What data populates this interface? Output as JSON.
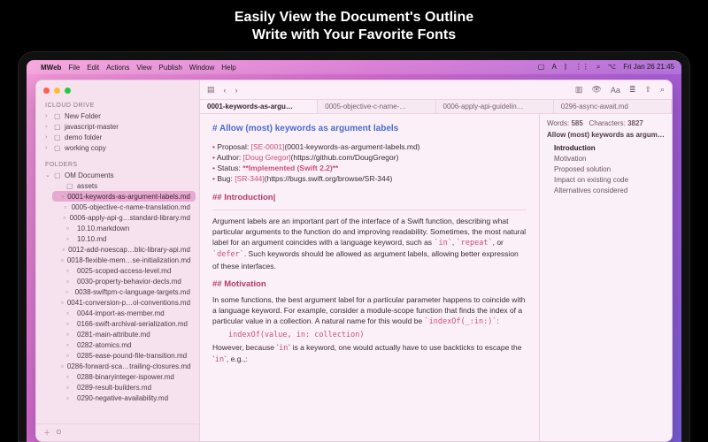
{
  "promo": {
    "headline1": "Easily View the Document's Outline",
    "headline2": "Write with Your Favorite Fonts"
  },
  "menubar": {
    "app": "MWeb",
    "items": [
      "File",
      "Edit",
      "Actions",
      "View",
      "Publish",
      "Window",
      "Help"
    ],
    "clock": "Fri Jan 26  21:45"
  },
  "sidebar": {
    "section_cloud": "ICLOUD DRIVE",
    "cloud_items": [
      {
        "label": "New Folder",
        "kind": "folder",
        "expandable": true
      },
      {
        "label": "javascript-master",
        "kind": "folder",
        "expandable": true
      },
      {
        "label": "demo folder",
        "kind": "folder",
        "expandable": true
      },
      {
        "label": "working copy",
        "kind": "folder",
        "expandable": true
      }
    ],
    "section_folders": "FOLDERS",
    "root": {
      "label": "OM Documents",
      "open": true
    },
    "assets": {
      "label": "assets"
    },
    "files": [
      "0001-keywords-as-argument-labels.md",
      "0005-objective-c-name-translation.md",
      "0006-apply-api-g…standard-library.md",
      "10.10.markdown",
      "10.10.md",
      "0012-add-noescap…blic-library-api.md",
      "0018-flexible-mem…se-initialization.md",
      "0025-scoped-access-level.md",
      "0030-property-behavior-decls.md",
      "0038-swiftpm-c-language-targets.md",
      "0041-conversion-p…ol-conventions.md",
      "0044-import-as-member.md",
      "0166-swift-archival-serialization.md",
      "0281-main-attribute.md",
      "0282-atomics.md",
      "0285-ease-pound-file-transition.md",
      "0286-forward-sca…trailing-closures.md",
      "0288-binaryinteger-ispower.md",
      "0289-result-builders.md",
      "0290-negative-availability.md"
    ],
    "selected_index": 0
  },
  "toolbar": {
    "icons": [
      "sidebar",
      "back",
      "forward"
    ],
    "right_icons": [
      "preview",
      "eye",
      "font",
      "outline",
      "share",
      "search"
    ],
    "font_label": "Aa"
  },
  "tabs": {
    "items": [
      "0001-keywords-as-argu…",
      "0005-objective-c-name-…",
      "0006-apply-api-guidelin…",
      "0296-async-await.md"
    ],
    "active": 0
  },
  "document": {
    "h1": "# Allow (most) keywords as argument labels",
    "meta": {
      "proposal_label": "Proposal:",
      "proposal_link": "[SE-0001]",
      "proposal_target": "(0001-keywords-as-argument-labels.md)",
      "author_label": "Author:",
      "author_link": "[Doug Gregor]",
      "author_target": "(https://github.com/DougGregor)",
      "status_label": "Status:",
      "status_value": "**Implemented (Swift 2.2)**",
      "bug_label": "Bug:",
      "bug_link": "[SR-344]",
      "bug_target": "(https://bugs.swift.org/browse/SR-344)"
    },
    "h2_intro": "## Introduction",
    "intro_para": "Argument labels are an important part of the interface of a Swift function, describing what particular arguments to the function do and improving readability. Sometimes, the most natural label for an argument coincides with a language keyword, such as `in`, `repeat`, or `defer`. Such keywords should be allowed as argument labels, allowing better expression of these interfaces.",
    "h2_motivation": "## Motivation",
    "motivation_para1": "In some functions, the best argument label for a particular parameter happens to coincide with a language keyword. For example, consider a module-scope function that finds the index of a particular value in a collection. A natural name for this would be `indexOf(_:in:)`:",
    "codeblock": "indexOf(value, in: collection)",
    "motivation_para2a": "However, because `",
    "motivation_in": "in",
    "motivation_para2b": "` is a keyword, one would actually have to use backticks to escape the `",
    "motivation_para2c": "`, e.g.,:"
  },
  "outline": {
    "words_label": "Words:",
    "words": "585",
    "chars_label": "Characters:",
    "chars": "3827",
    "title": "Allow (most) keywords as argume…",
    "items": [
      "Introduction",
      "Motivation",
      "Proposed solution",
      "Impact on existing code",
      "Alternatives considered"
    ],
    "selected": 0
  }
}
